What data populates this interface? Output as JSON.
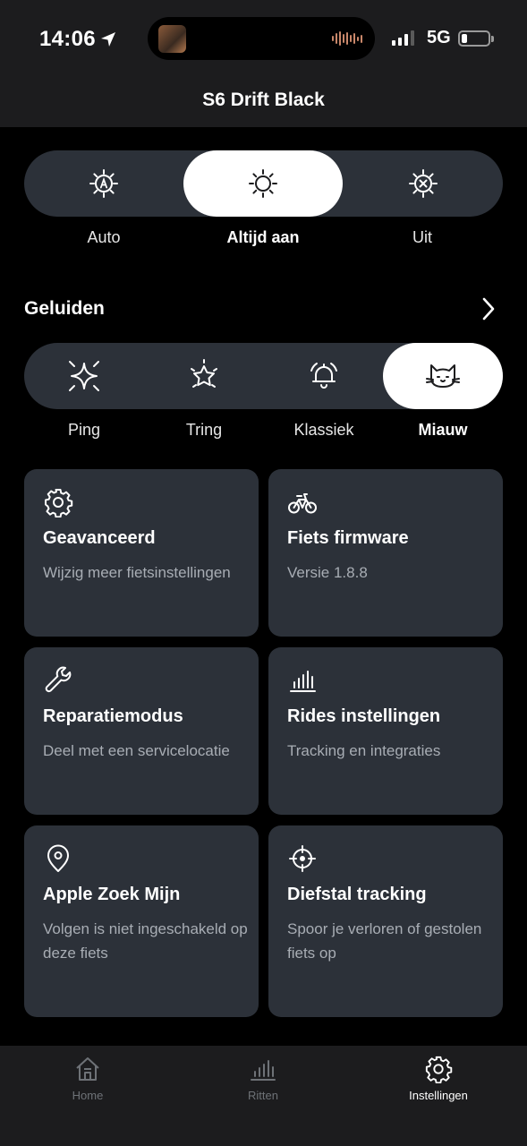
{
  "status_bar": {
    "time": "14:06",
    "network": "5G"
  },
  "header": {
    "title": "S6 Drift Black"
  },
  "light_mode": {
    "options": [
      {
        "label": "Auto",
        "icon": "sun-auto-icon"
      },
      {
        "label": "Altijd aan",
        "icon": "sun-icon"
      },
      {
        "label": "Uit",
        "icon": "sun-off-icon"
      }
    ],
    "selected": "Altijd aan"
  },
  "sounds": {
    "title": "Geluiden",
    "options": [
      {
        "label": "Ping",
        "icon": "sparkle-icon"
      },
      {
        "label": "Tring",
        "icon": "star-icon"
      },
      {
        "label": "Klassiek",
        "icon": "bell-icon"
      },
      {
        "label": "Miauw",
        "icon": "cat-icon"
      }
    ],
    "selected": "Miauw"
  },
  "cards": [
    {
      "title": "Geavanceerd",
      "subtitle": "Wijzig meer fietsinstellingen",
      "icon": "gear-icon"
    },
    {
      "title": "Fiets firmware",
      "subtitle": "Versie 1.8.8",
      "icon": "bike-icon"
    },
    {
      "title": "Reparatiemodus",
      "subtitle": "Deel met een servicelocatie",
      "icon": "wrench-icon"
    },
    {
      "title": "Rides instellingen",
      "subtitle": "Tracking en integraties",
      "icon": "bar-chart-icon"
    },
    {
      "title": "Apple Zoek Mijn",
      "subtitle": "Volgen is niet ingeschakeld op deze fiets",
      "icon": "location-pin-icon"
    },
    {
      "title": "Diefstal tracking",
      "subtitle": "Spoor je verloren of gestolen fiets op",
      "icon": "crosshair-icon"
    }
  ],
  "tabbar": {
    "tabs": [
      {
        "label": "Home",
        "icon": "house-icon"
      },
      {
        "label": "Ritten",
        "icon": "bar-chart-icon"
      },
      {
        "label": "Instellingen",
        "icon": "gear-icon"
      }
    ],
    "active": "Instellingen"
  },
  "colors": {
    "background": "#000000",
    "surface": "#2c3139",
    "bar": "#1c1c1e",
    "selected": "#ffffff",
    "muted_text": "#a8adb4"
  }
}
